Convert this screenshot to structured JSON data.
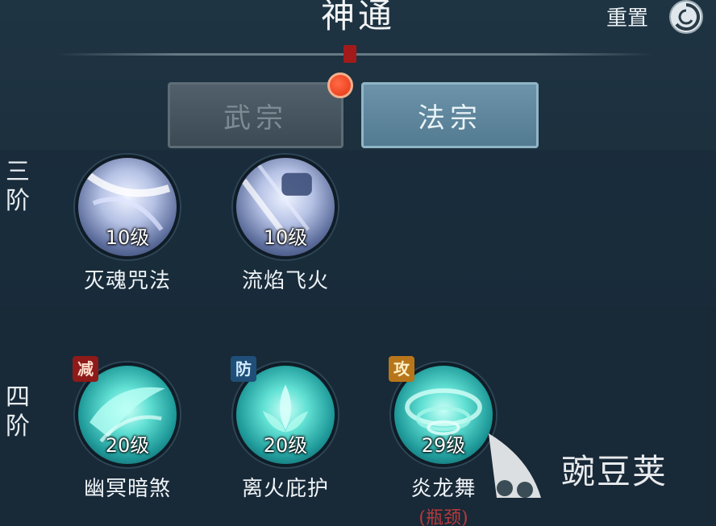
{
  "header": {
    "title": "神通",
    "reset_label": "重置"
  },
  "tabs": [
    {
      "label": "武宗",
      "active": false,
      "has_notification": true
    },
    {
      "label": "法宗",
      "active": true,
      "has_notification": false
    }
  ],
  "tiers": [
    {
      "label": "三阶",
      "skills": [
        {
          "level": "10级",
          "name": "灭魂咒法"
        },
        {
          "level": "10级",
          "name": "流焰飞火"
        }
      ]
    },
    {
      "label": "四阶",
      "skills": [
        {
          "badge": "减",
          "level": "20级",
          "name": "幽冥暗煞"
        },
        {
          "badge": "防",
          "level": "20级",
          "name": "离火庇护"
        },
        {
          "badge": "攻",
          "level": "29级",
          "name": "炎龙舞",
          "note": "(瓶颈)"
        }
      ]
    }
  ],
  "watermark": {
    "text": "豌豆荚"
  },
  "colors": {
    "background": "#1b2f3d",
    "tab_active": "#6c93a9",
    "tab_inactive": "#44535e",
    "notification_dot": "#e73415",
    "bottleneck_note": "#b63a3a",
    "badge_reduce": "#8e1a1a",
    "badge_defense": "#1f4f78",
    "badge_attack": "#b8761a"
  }
}
